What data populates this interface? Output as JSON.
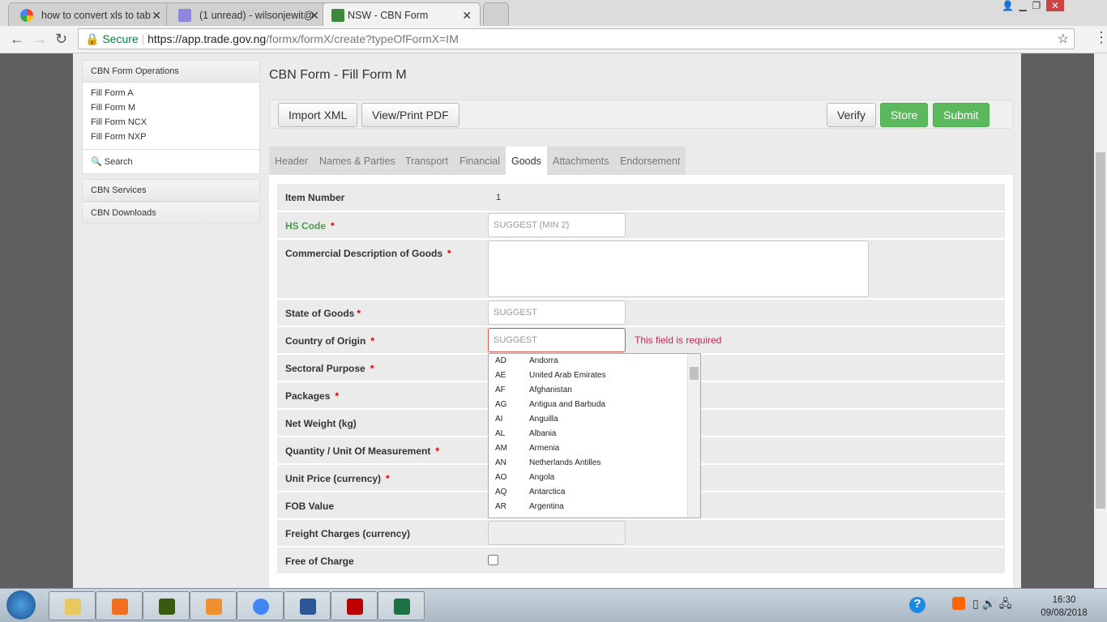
{
  "browser": {
    "tabs": [
      {
        "title": "how to convert xls to tab",
        "icon": "google-icon",
        "active": false
      },
      {
        "title": "(1 unread) - wilsonjewit@",
        "icon": "mail-icon",
        "active": false
      },
      {
        "title": "NSW - CBN Form",
        "icon": "coat-of-arms-icon",
        "active": true
      }
    ],
    "secure_label": "Secure",
    "url_host": "https://app.trade.gov.ng",
    "url_path": "/formx/formX/create?typeOfFormX=IM"
  },
  "sidebar": {
    "operations_title": "CBN Form Operations",
    "items": [
      "Fill Form A",
      "Fill Form M",
      "Fill Form NCX",
      "Fill Form NXP"
    ],
    "search_label": "Search",
    "services": "CBN Services",
    "downloads": "CBN Downloads"
  },
  "main": {
    "title": "CBN Form - Fill Form M",
    "toolbar": {
      "import": "Import XML",
      "pdf": "View/Print PDF",
      "verify": "Verify",
      "store": "Store",
      "submit": "Submit"
    },
    "tabs": [
      "Header",
      "Names & Parties",
      "Transport",
      "Financial",
      "Goods",
      "Attachments",
      "Endorsement"
    ],
    "active_tab": "Goods",
    "fields": {
      "item_number": {
        "label": "Item Number",
        "value": "1"
      },
      "hs_code": {
        "label": "HS Code",
        "placeholder": "SUGGEST (MIN 2)"
      },
      "description": {
        "label": "Commercial Description of Goods"
      },
      "state": {
        "label": "State of Goods",
        "placeholder": "SUGGEST"
      },
      "country": {
        "label": "Country of Origin",
        "placeholder": "SUGGEST",
        "error": "This field is required"
      },
      "sectoral": {
        "label": "Sectoral Purpose"
      },
      "packages": {
        "label": "Packages"
      },
      "net_weight": {
        "label": "Net Weight (kg)"
      },
      "quantity": {
        "label": "Quantity / Unit Of Measurement"
      },
      "unit_price": {
        "label": "Unit Price (currency)"
      },
      "fob": {
        "label": "FOB Value"
      },
      "freight": {
        "label": "Freight Charges (currency)"
      },
      "free": {
        "label": "Free of Charge",
        "checked": false
      }
    },
    "required_mark": "*",
    "country_options": [
      [
        "AD",
        "Andorra"
      ],
      [
        "AE",
        "United Arab Emirates"
      ],
      [
        "AF",
        "Afghanistan"
      ],
      [
        "AG",
        "Antigua and Barbuda"
      ],
      [
        "AI",
        "Anguilla"
      ],
      [
        "AL",
        "Albania"
      ],
      [
        "AM",
        "Armenia"
      ],
      [
        "AN",
        "Netherlands Antilles"
      ],
      [
        "AO",
        "Angola"
      ],
      [
        "AQ",
        "Antarctica"
      ],
      [
        "AR",
        "Argentina"
      ]
    ]
  },
  "taskbar": {
    "time": "16:30",
    "date": "09/08/2018",
    "apps": [
      "explorer-icon",
      "media-player-icon",
      "dreamweaver-icon",
      "photo-gallery-icon",
      "chrome-icon",
      "word-icon",
      "acrobat-icon",
      "excel-icon"
    ]
  },
  "colors": {
    "green": "#5cb85c",
    "error": "#c7254e",
    "hs_label": "#4a9a4a"
  }
}
